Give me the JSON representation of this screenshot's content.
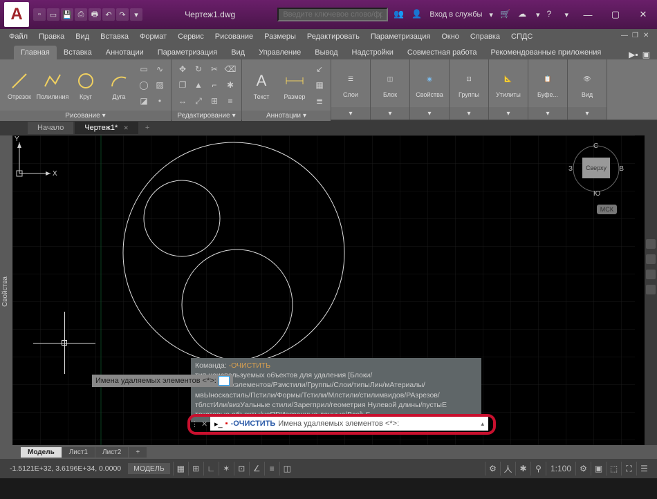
{
  "title": {
    "document": "Чертеж1.dwg"
  },
  "search": {
    "placeholder": "Введите ключевое слово/фразу"
  },
  "login": {
    "label": "Вход в службы"
  },
  "menubar": [
    "Файл",
    "Правка",
    "Вид",
    "Вставка",
    "Формат",
    "Сервис",
    "Рисование",
    "Размеры",
    "Редактировать",
    "Параметризация",
    "Окно",
    "Справка",
    "СПДС"
  ],
  "ribbon_tabs": [
    "Главная",
    "Вставка",
    "Аннотации",
    "Параметризация",
    "Вид",
    "Управление",
    "Вывод",
    "Надстройки",
    "Совместная работа",
    "Рекомендованные приложения"
  ],
  "panels": {
    "draw": {
      "label": "Рисование",
      "items": [
        "Отрезок",
        "Полилиния",
        "Круг",
        "Дуга"
      ]
    },
    "edit": {
      "label": "Редактирование"
    },
    "anno": {
      "label": "Аннотации",
      "items": [
        "Текст",
        "Размер"
      ]
    },
    "layers": {
      "label": "Слои"
    },
    "block": {
      "label": "Блок"
    },
    "props": {
      "label": "Свойства"
    },
    "groups": {
      "label": "Группы"
    },
    "utils": {
      "label": "Утилиты"
    },
    "clip": {
      "label": "Буфе..."
    },
    "view": {
      "label": "Вид"
    }
  },
  "file_tabs": {
    "start": "Начало",
    "doc": "Чертеж1*"
  },
  "side_panel_label": "Свойства",
  "viewcube": {
    "top": "Сверху",
    "n": "С",
    "e": "В",
    "s": "Ю",
    "w": "З"
  },
  "ncs": "МСК",
  "tooltip_text": "Имена удаляемых элементов <*>:",
  "cmd_history": {
    "line1_a": "Команда: ",
    "line1_b": "-ОЧИСТИТЬ",
    "line2": "      тип неиспользуемых объектов для удаления [Блоки/",
    "line3": "мвЫаосныхэлементов/Рзмстили/Группы/Слои/типыЛин/мАтериалы/",
    "line4": "мвЫноскастиль/Пстили/Формы/Тстили/Млстили/стилимвидов/РАзрезов/",
    "line5": "тблстИли/визУальные стили/Зарегприл/геометрия Нулевой длины/пустыЕ",
    "line6": "текстовые объекты/неПРИвязанные данные/Все]: Б"
  },
  "cmdline": {
    "keyword": "-ОЧИСТИТЬ",
    "rest": "Имена удаляемых элементов <*>:"
  },
  "model_tabs": [
    "Модель",
    "Лист1",
    "Лист2"
  ],
  "status": {
    "coords": "-1.5121E+32, 3.6196E+34, 0.0000",
    "model": "МОДЕЛЬ",
    "scale": "1:100"
  },
  "ucs": {
    "x": "X",
    "y": "Y"
  }
}
